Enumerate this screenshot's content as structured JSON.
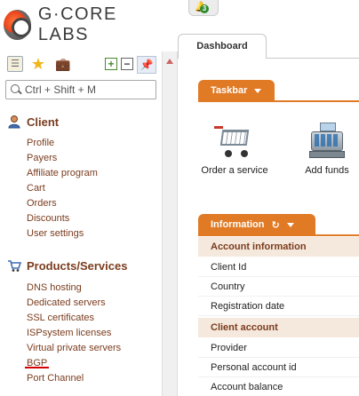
{
  "brand": {
    "name": "G·CORE LABS"
  },
  "notification": {
    "count": "3"
  },
  "search": {
    "placeholder": "Ctrl + Shift + M"
  },
  "sidebar": {
    "client": {
      "title": "Client",
      "items": [
        "Profile",
        "Payers",
        "Affiliate program",
        "Cart",
        "Orders",
        "Discounts",
        "User settings"
      ]
    },
    "products": {
      "title": "Products/Services",
      "items": [
        "DNS hosting",
        "Dedicated servers",
        "SSL certificates",
        "ISPsystem licenses",
        "Virtual private servers",
        "BGP",
        "Port Channel"
      ]
    }
  },
  "tabs": {
    "dashboard": "Dashboard"
  },
  "taskbar": {
    "title": "Taskbar",
    "items": [
      {
        "label": "Order a service",
        "icon": "shopping-cart-icon"
      },
      {
        "label": "Add funds",
        "icon": "cash-register-icon"
      }
    ]
  },
  "information": {
    "title": "Information",
    "groups": [
      {
        "title": "Account information",
        "rows": [
          "Client Id",
          "Country",
          "Registration date"
        ]
      },
      {
        "title": "Client account",
        "rows": [
          "Provider",
          "Personal account id",
          "Account balance"
        ]
      }
    ]
  },
  "colors": {
    "accent": "#e07a25",
    "link": "#7a3c1e",
    "group_bg": "#f5e8dc",
    "highlight_underline": "#d40000"
  }
}
